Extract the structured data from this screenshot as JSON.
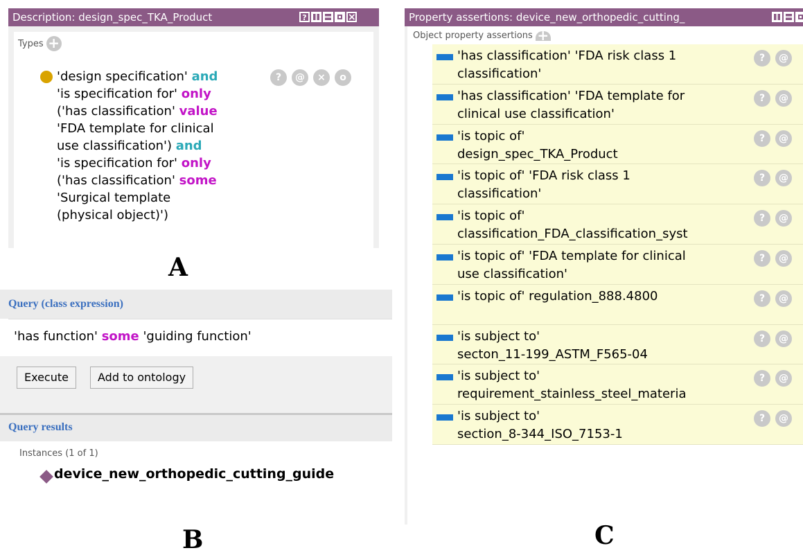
{
  "panel_a": {
    "title": "Description: design_spec_TKA_Product",
    "types_label": "Types",
    "expression_lines": [
      [
        {
          "t": "'design specification' ",
          "k": ""
        },
        {
          "t": "and",
          "k": "and"
        }
      ],
      [
        {
          "t": "'is specification for' ",
          "k": ""
        },
        {
          "t": "only",
          "k": "pur"
        }
      ],
      [
        {
          "t": "('has classification' ",
          "k": ""
        },
        {
          "t": "value",
          "k": "pur"
        }
      ],
      [
        {
          "t": "'FDA template for clinical",
          "k": ""
        }
      ],
      [
        {
          "t": "use classification') ",
          "k": ""
        },
        {
          "t": "and",
          "k": "and"
        }
      ],
      [
        {
          "t": "'is specification for' ",
          "k": ""
        },
        {
          "t": "only",
          "k": "pur"
        }
      ],
      [
        {
          "t": "('has classification' ",
          "k": ""
        },
        {
          "t": "some",
          "k": "pur"
        }
      ],
      [
        {
          "t": "'Surgical template",
          "k": ""
        }
      ],
      [
        {
          "t": "(physical object)')",
          "k": ""
        }
      ]
    ],
    "controls": [
      "?",
      "@",
      "×",
      "o"
    ],
    "letter": "A",
    "colors": {
      "title_bg": "#8b5a86",
      "dot": "#d9a300"
    }
  },
  "panel_b": {
    "query_header": "Query (class expression)",
    "query_parts": [
      {
        "t": "'has function' ",
        "k": ""
      },
      {
        "t": "some",
        "k": "pur"
      },
      {
        "t": " 'guiding function'",
        "k": ""
      }
    ],
    "execute_label": "Execute",
    "add_label": "Add to ontology",
    "results_header": "Query results",
    "instances_label": "Instances (1 of 1)",
    "result_item": "device_new_orthopedic_cutting_guide",
    "letter": "B"
  },
  "panel_c": {
    "title": "Property assertions: device_new_orthopedic_cutting_",
    "section_label": "Object property assertions",
    "rows": [
      [
        "'has classification'  'FDA risk class 1",
        "classification'"
      ],
      [
        "'has classification'  'FDA template for",
        "clinical use classification'"
      ],
      [
        "'is topic of'",
        "design_spec_TKA_Product"
      ],
      [
        "'is topic of'  'FDA risk class 1",
        "classification'"
      ],
      [
        "'is topic of'",
        "classification_FDA_classification_syst"
      ],
      [
        "'is topic of'  'FDA template for clinical",
        "use classification'"
      ],
      [
        "'is topic of'  regulation_888.4800",
        ""
      ],
      [
        "'is subject to'",
        "secton_11-199_ASTM_F565-04"
      ],
      [
        "'is subject to'",
        "requirement_stainless_steel_materia"
      ],
      [
        "'is subject to'",
        "section_8-344_ISO_7153-1"
      ]
    ],
    "row_controls": [
      "?",
      "@"
    ],
    "letter": "C",
    "colors": {
      "row_bg": "#fbfbd6",
      "bar": "#1a78d0"
    }
  }
}
